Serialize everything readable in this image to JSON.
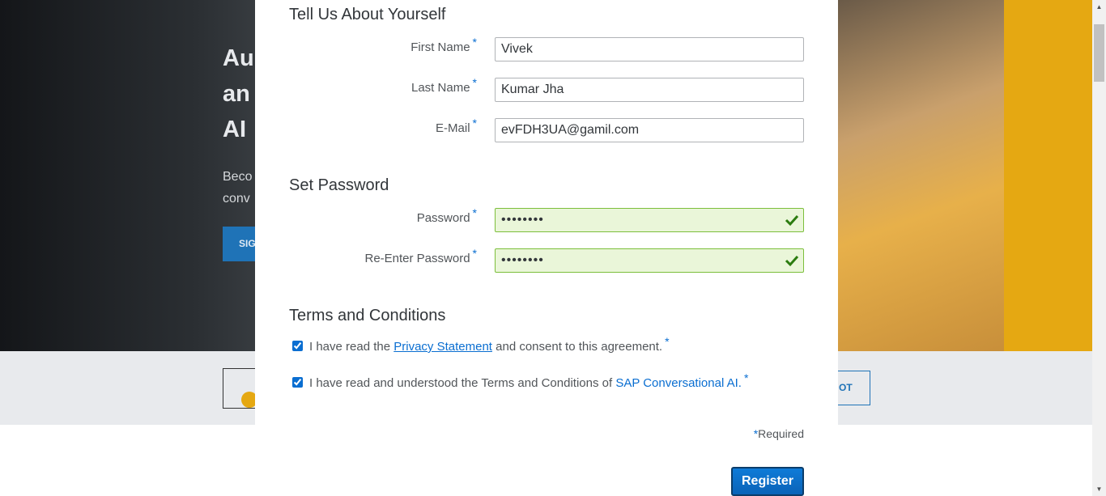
{
  "background": {
    "headline": "Au\nan\nAI",
    "subtext": "Beco\nconv",
    "hero_button_label": "SIG",
    "strip_button_label": "OT"
  },
  "modal": {
    "about": {
      "title": "Tell Us About Yourself",
      "first_name": {
        "label": "First Name",
        "value": "Vivek"
      },
      "last_name": {
        "label": "Last Name",
        "value": "Kumar Jha"
      },
      "email": {
        "label": "E-Mail",
        "value": "evFDH3UA@gamil.com"
      }
    },
    "password": {
      "title": "Set Password",
      "password": {
        "label": "Password",
        "value": "••••••••"
      },
      "reenter": {
        "label": "Re-Enter Password",
        "value": "••••••••"
      }
    },
    "terms": {
      "title": "Terms and Conditions",
      "privacy": {
        "prefix": "I have read the ",
        "link": "Privacy Statement",
        "suffix": " and consent to this agreement.",
        "checked": true
      },
      "tc": {
        "prefix": "I have read and understood the Terms and Conditions of ",
        "link": "SAP Conversational AI.",
        "checked": true
      }
    },
    "required_marker": "*",
    "required_note": "Required",
    "register_label": "Register"
  },
  "colors": {
    "accent": "#0a6ed1",
    "valid_bg": "#eaf6d9",
    "valid_check": "#2b7c0f"
  }
}
